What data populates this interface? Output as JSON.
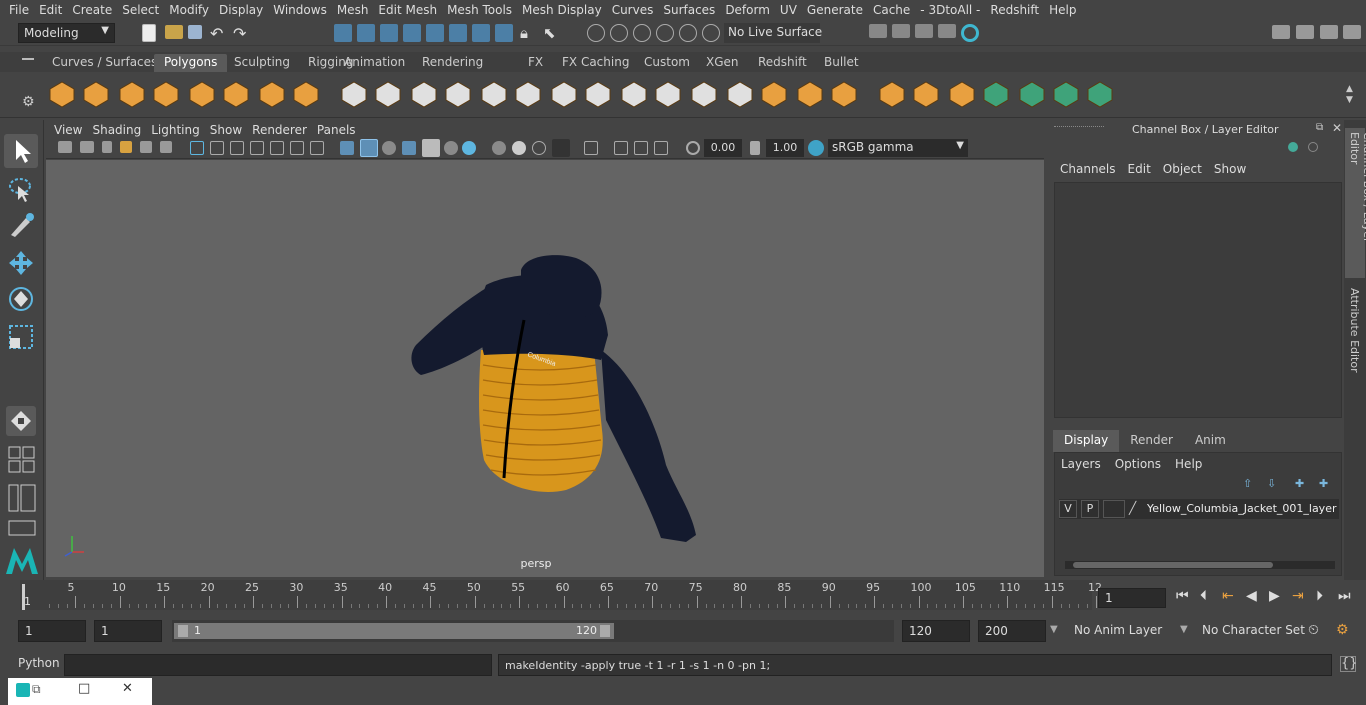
{
  "menubar": [
    "File",
    "Edit",
    "Create",
    "Select",
    "Modify",
    "Display",
    "Windows",
    "Mesh",
    "Edit Mesh",
    "Mesh Tools",
    "Mesh Display",
    "Curves",
    "Surfaces",
    "Deform",
    "UV",
    "Generate",
    "Cache",
    "- 3DtoAll -",
    "Redshift",
    "Help"
  ],
  "status": {
    "mode": "Modeling",
    "live_surface": "No Live Surface"
  },
  "shelf_tabs": [
    "Curves / Surfaces",
    "Polygons",
    "Sculpting",
    "Rigging",
    "Animation",
    "Rendering",
    "FX",
    "FX Caching",
    "Custom",
    "XGen",
    "Redshift",
    "Bullet"
  ],
  "shelf_active": "Polygons",
  "viewport": {
    "menu": [
      "View",
      "Shading",
      "Lighting",
      "Show",
      "Renderer",
      "Panels"
    ],
    "exposure": "0.00",
    "gamma": "1.00",
    "colorspace": "sRGB gamma",
    "camera_label": "persp",
    "brand_text": "Columbia"
  },
  "channel_box": {
    "title": "Channel Box / Layer Editor",
    "menu": [
      "Channels",
      "Edit",
      "Object",
      "Show"
    ],
    "tabs": [
      "Display",
      "Render",
      "Anim"
    ],
    "active_tab": "Display",
    "layer_menu": [
      "Layers",
      "Options",
      "Help"
    ],
    "layer": {
      "v": "V",
      "p": "P",
      "name": "Yellow_Columbia_Jacket_001_layer"
    }
  },
  "side_tabs": [
    "Channel Box / Layer Editor",
    "Attribute Editor"
  ],
  "timeline": {
    "ticks": [
      "5",
      "10",
      "15",
      "20",
      "25",
      "30",
      "35",
      "40",
      "45",
      "50",
      "55",
      "60",
      "65",
      "70",
      "75",
      "80",
      "85",
      "90",
      "95",
      "100",
      "105",
      "110",
      "115",
      "12"
    ],
    "start_label": "1",
    "current_frame": "1"
  },
  "range": {
    "start": "1",
    "anim_start": "1",
    "slider_start": "1",
    "slider_end": "120",
    "end": "120",
    "anim_end": "200",
    "anim_layer": "No Anim Layer",
    "char_set": "No Character Set"
  },
  "command": {
    "lang": "Python",
    "output": "makeIdentity -apply true -t 1 -r 1 -s 1 -n 0 -pn 1;"
  },
  "colors": {
    "accent": "#5285a6",
    "shelf_orange": "#e8a040",
    "shelf_green": "#3fa37a",
    "jacket_yellow": "#d8961c",
    "jacket_navy": "#141a2e"
  }
}
